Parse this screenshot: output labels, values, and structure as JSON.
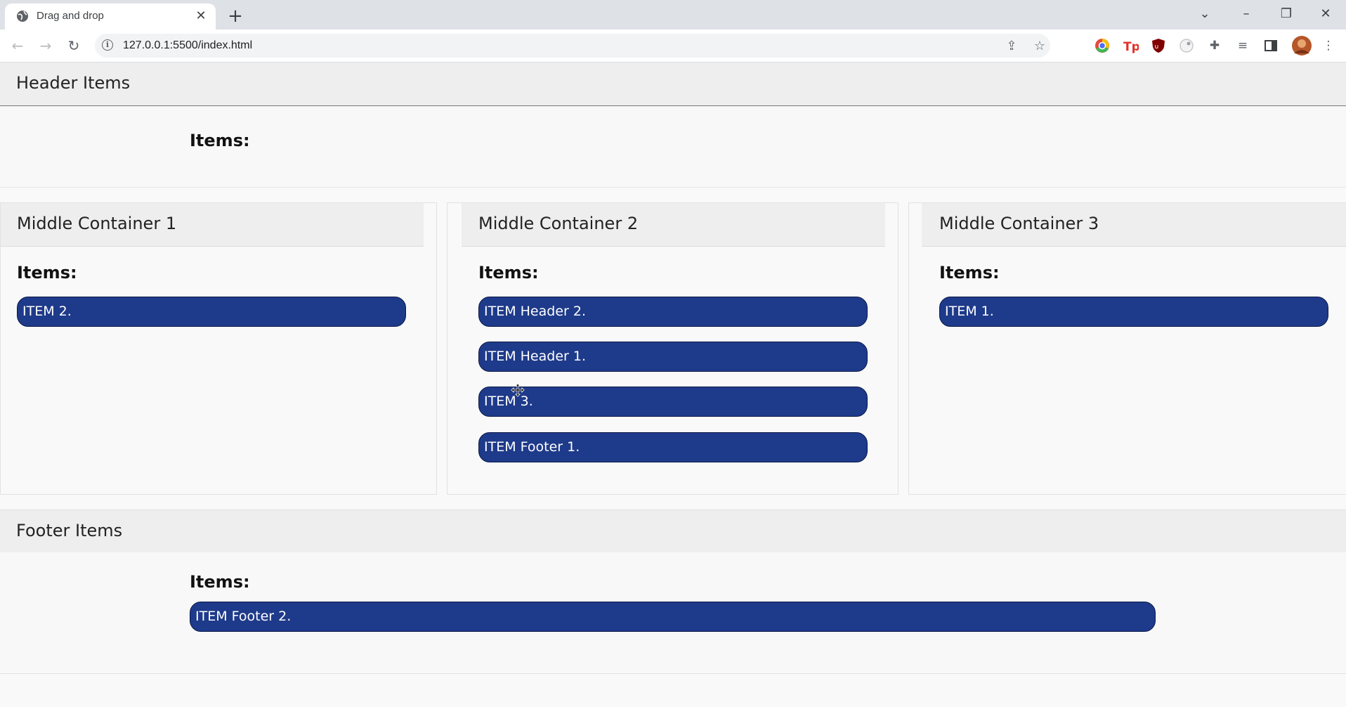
{
  "browser": {
    "tab_title": "Drag and drop",
    "url": "127.0.0.1:5500/index.html"
  },
  "header": {
    "title": "Header Items",
    "items_label": "Items:"
  },
  "containers": [
    {
      "title": "Middle Container 1",
      "items_label": "Items:",
      "items": [
        "ITEM 2."
      ]
    },
    {
      "title": "Middle Container 2",
      "items_label": "Items:",
      "items": [
        "ITEM Header 2.",
        "ITEM Header 1.",
        "ITEM 3.",
        "ITEM Footer 1."
      ]
    },
    {
      "title": "Middle Container 3",
      "items_label": "Items:",
      "items": [
        "ITEM 1."
      ]
    }
  ],
  "footer": {
    "title": "Footer Items",
    "items_label": "Items:",
    "items": [
      "ITEM Footer 2."
    ]
  },
  "colors": {
    "item_bg": "#1e3a8a",
    "item_border": "#0c1a4a",
    "section_head_bg": "#eeeeee"
  }
}
